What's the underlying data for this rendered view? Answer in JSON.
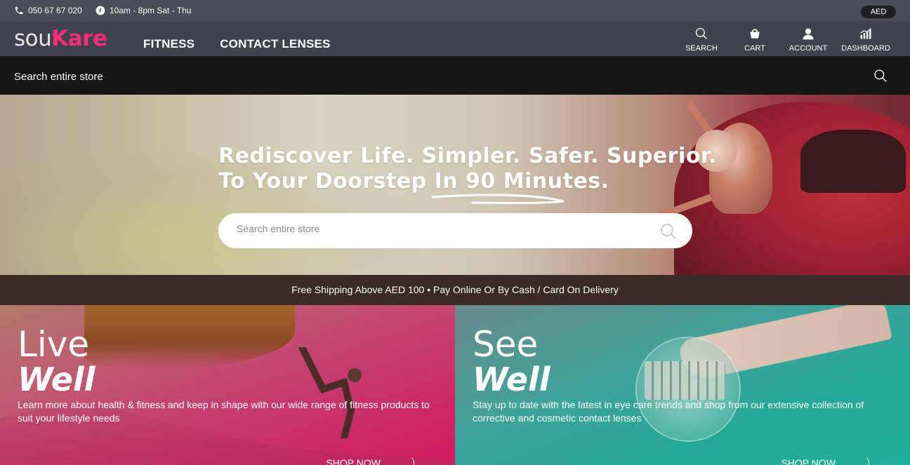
{
  "topbar": {
    "phone": "050 67 67 020",
    "hours": "10am - 8pm Sat - Thu",
    "currency": "AED"
  },
  "header": {
    "logo_part1": "sou",
    "logo_part2": "Kare",
    "nav": [
      {
        "label": "FITNESS"
      },
      {
        "label": "CONTACT LENSES"
      }
    ],
    "actions": [
      {
        "label": "SEARCH",
        "icon": "search-icon"
      },
      {
        "label": "CART",
        "icon": "cart-icon"
      },
      {
        "label": "ACCOUNT",
        "icon": "user-icon"
      },
      {
        "label": "DASHBOARD",
        "icon": "chart-icon"
      }
    ]
  },
  "search_strip": {
    "label": "Search entire store"
  },
  "hero": {
    "line1": "Rediscover Life. Simpler. Safer. Superior.",
    "line2": "To Your Doorstep In 90 Minutes.",
    "search_placeholder": "Search entire store"
  },
  "shipping": {
    "text": "Free Shipping Above AED 100 • Pay Online Or By Cash / Card On Delivery"
  },
  "panels": [
    {
      "title_top": "Live",
      "title_bottom": "Well",
      "description": "Learn more about health & fitness and keep in shape with our wide range of fitness products to suit your lifestyle needs",
      "cta": "SHOP NOW"
    },
    {
      "title_top": "See",
      "title_bottom": "Well",
      "description": "Stay up to date with the latest in eye care trends and shop from our extensive collection of corrective and cosmetic contact lenses",
      "cta": "SHOP NOW"
    }
  ],
  "colors": {
    "brand_pink": "#ff2d7a",
    "header_bg": "#40434d",
    "topbar_bg": "#4a4d58"
  }
}
